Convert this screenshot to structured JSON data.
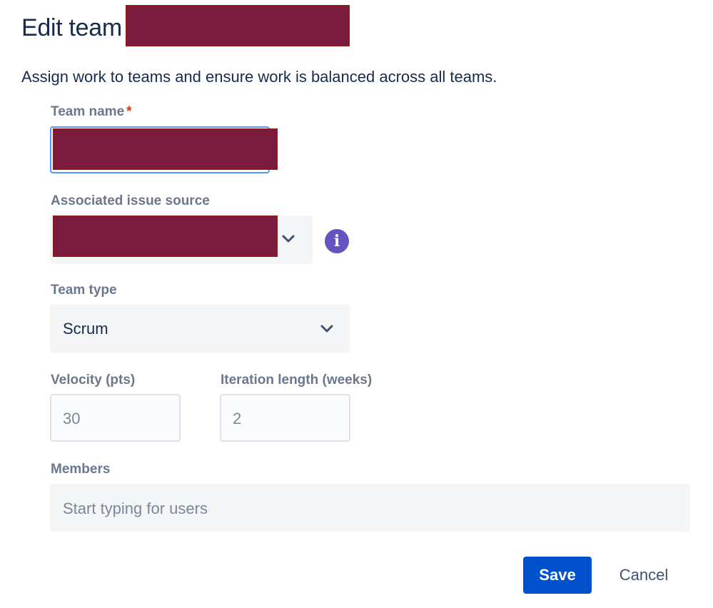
{
  "header": {
    "title": "Edit team"
  },
  "description": "Assign work to teams and ensure work is balanced across all teams.",
  "form": {
    "team_name": {
      "label": "Team name",
      "required_marker": "*"
    },
    "issue_source": {
      "label": "Associated issue source",
      "info_icon": "info-icon"
    },
    "team_type": {
      "label": "Team type",
      "value": "Scrum"
    },
    "velocity": {
      "label": "Velocity (pts)",
      "value": "30"
    },
    "iteration_length": {
      "label": "Iteration length (weeks)",
      "value": "2"
    },
    "members": {
      "label": "Members",
      "placeholder": "Start typing for users"
    }
  },
  "actions": {
    "save_label": "Save",
    "cancel_label": "Cancel"
  },
  "colors": {
    "primary": "#0052cc",
    "focus_border": "#4c9aff",
    "required": "#de350b",
    "info": "#6554c0",
    "redaction": "#7a1a3c"
  }
}
